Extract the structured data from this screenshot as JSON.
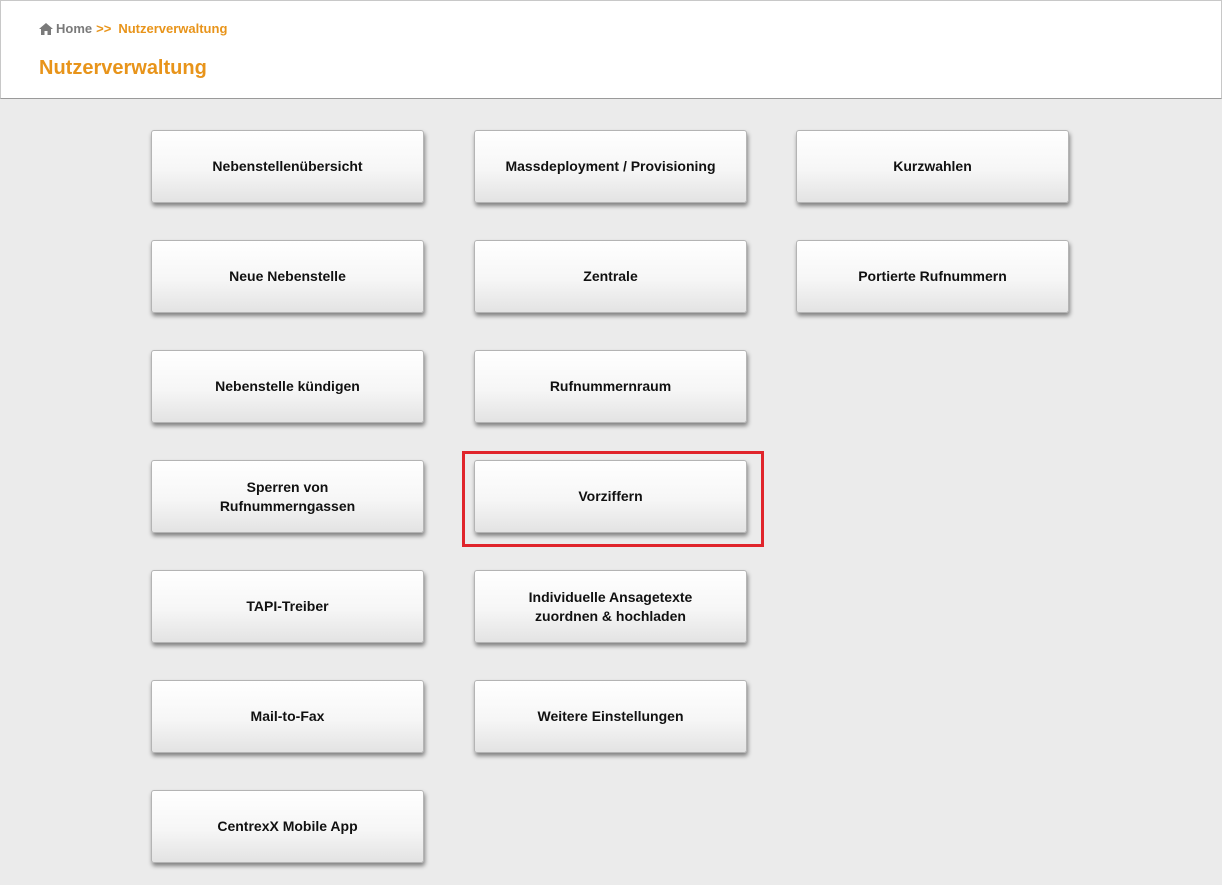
{
  "breadcrumb": {
    "home_icon": "home-icon",
    "home_label": "Home",
    "separator": ">>",
    "current": "Nutzerverwaltung"
  },
  "page_title": "Nutzerverwaltung",
  "accent_color": "#e8941a",
  "highlight_color": "#e0242b",
  "tiles": {
    "nebenstellenuebersicht": "Nebenstellenübersicht",
    "massdeployment": "Massdeployment / Provisioning",
    "kurzwahlen": "Kurzwahlen",
    "neue_nebenstelle": "Neue Nebenstelle",
    "zentrale": "Zentrale",
    "portierte_rufnummern": "Portierte Rufnummern",
    "nebenstelle_kuendigen": "Nebenstelle kündigen",
    "rufnummernraum": "Rufnummernraum",
    "sperren_line1": "Sperren von",
    "sperren_line2": "Rufnummerngassen",
    "vorziffern": "Vorziffern",
    "tapi_treiber": "TAPI-Treiber",
    "ansagetexte_line1": "Individuelle Ansagetexte",
    "ansagetexte_line2": "zuordnen & hochladen",
    "mail_to_fax": "Mail-to-Fax",
    "weitere_einstellungen": "Weitere Einstellungen",
    "centrexx_mobile_app": "CentrexX Mobile App"
  }
}
